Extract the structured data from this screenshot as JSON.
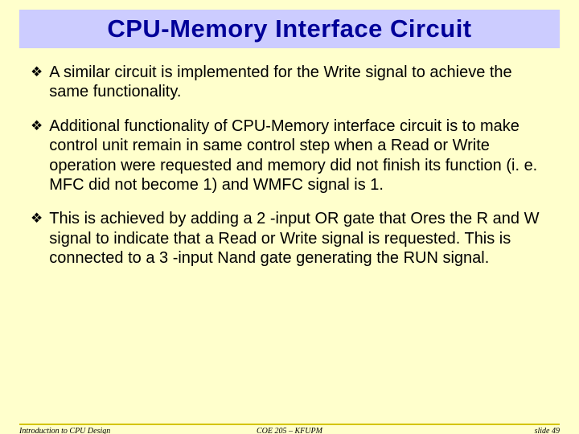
{
  "title": "CPU-Memory Interface Circuit",
  "bullets": [
    "A similar circuit is implemented for the Write signal to achieve the same functionality.",
    "Additional functionality of CPU-Memory interface circuit is to make control unit remain in same control step when a Read or Write operation were requested and memory did not finish its function (i. e. MFC did not become 1) and WMFC signal is 1.",
    "This is achieved by adding a 2 -input OR gate that Ores the R and W signal to indicate that a Read or Write signal is requested. This is connected to a 3 -input Nand gate generating the RUN signal."
  ],
  "footer": {
    "left": "Introduction to CPU Design",
    "center": "COE 205 – KFUPM",
    "right": "slide 49"
  },
  "marker": "❖"
}
